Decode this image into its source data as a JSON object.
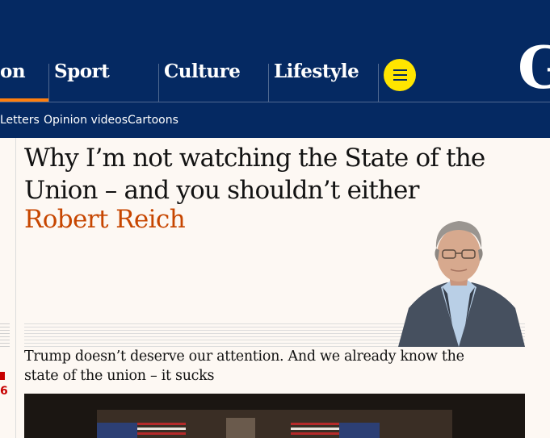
{
  "nav": {
    "pillars": [
      {
        "label": "on"
      },
      {
        "label": "Sport"
      },
      {
        "label": "Culture"
      },
      {
        "label": "Lifestyle"
      }
    ],
    "subnav": [
      "Letters",
      "Opinion videos",
      "Cartoons"
    ],
    "logo_text": "G",
    "menu_icon": "hamburger-icon"
  },
  "colors": {
    "brand_navy": "#052962",
    "accent_orange": "#ff7f0f",
    "menu_yellow": "#ffe500",
    "byline_orange": "#c74600",
    "background": "#fdf8f3"
  },
  "article": {
    "headline": "Why I’m not watching the State of the Union – and you shouldn’t either",
    "byline": "Robert Reich",
    "standfirst": "Trump doesn’t deserve our attention. And we already know the state of the union – it sucks"
  },
  "sidebar_left": {
    "count": "6"
  }
}
